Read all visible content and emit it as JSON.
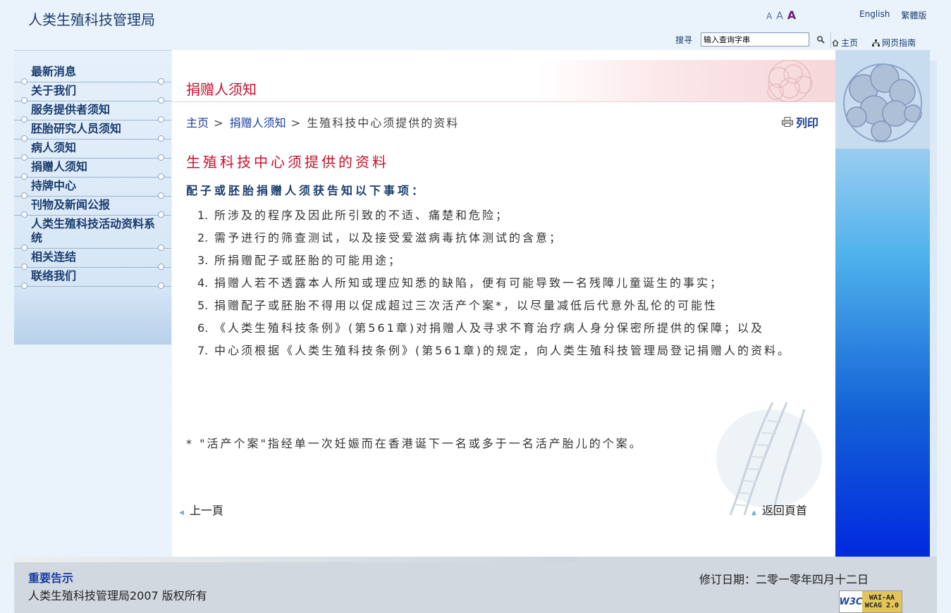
{
  "header": {
    "site_title": "人类生殖科技管理局",
    "font_sizes": [
      "A",
      "A",
      "A"
    ],
    "lang_english": "English",
    "lang_traditional": "繁體版",
    "search_label": "搜寻",
    "search_placeholder": "输入查询字串",
    "nav_home": "主页",
    "nav_sitemap": "网页指南"
  },
  "sidebar": {
    "items": [
      {
        "label": "最新消息"
      },
      {
        "label": "关于我们"
      },
      {
        "label": "服务提供者须知"
      },
      {
        "label": "胚胎研究人员须知"
      },
      {
        "label": "病人须知"
      },
      {
        "label": "捐赠人须知"
      },
      {
        "label": "持牌中心"
      },
      {
        "label": "刊物及新闻公报"
      },
      {
        "label": "人类生殖科技活动资料系统"
      },
      {
        "label": "相关连结"
      },
      {
        "label": "联络我们"
      }
    ]
  },
  "main": {
    "page_title": "捐赠人须知",
    "breadcrumb": {
      "home": "主页",
      "sep": " > ",
      "parent": "捐赠人须知",
      "current": "生殖科技中心须提供的资料"
    },
    "print_label": "列印",
    "section_title": "生殖科技中心须提供的资料",
    "subheading": "配子或胚胎捐赠人须获告知以下事项：",
    "items": [
      {
        "num": "1.",
        "text": "所涉及的程序及因此所引致的不适、痛楚和危险；"
      },
      {
        "num": "2.",
        "text": "需予进行的筛查测试，以及接受爱滋病毒抗体测试的含意；"
      },
      {
        "num": "3.",
        "text": "所捐赠配子或胚胎的可能用途；"
      },
      {
        "num": "4.",
        "text": "捐赠人若不透露本人所知或理应知悉的缺陷，便有可能导致一名残障儿童诞生的事实；"
      },
      {
        "num": "5.",
        "text": "捐赠配子或胚胎不得用以促成超过三次活产个案*，以尽量减低后代意外乱伦的可能性"
      },
      {
        "num": "6.",
        "text": "《人类生殖科技条例》(第561章)对捐赠人及寻求不育治疗病人身分保密所提供的保障；以及"
      },
      {
        "num": "7.",
        "text": "中心须根据《人类生殖科技条例》(第561章)的规定，向人类生殖科技管理局登记捐赠人的资料。"
      }
    ],
    "footnote": "* \"活产个案\"指经单一次妊娠而在香港诞下一名或多于一名活产胎儿的个案。",
    "prev_label": "上一頁",
    "back_top_label": "返回頁首"
  },
  "footer": {
    "notice": "重要告示",
    "copyright": "人类生殖科技管理局2007 版权所有",
    "revision": "修订日期：二零一零年四月十二日",
    "wcag_w3c": "W3C",
    "wcag_line1": "WAI-AA",
    "wcag_line2": "WCAG 2.0"
  }
}
